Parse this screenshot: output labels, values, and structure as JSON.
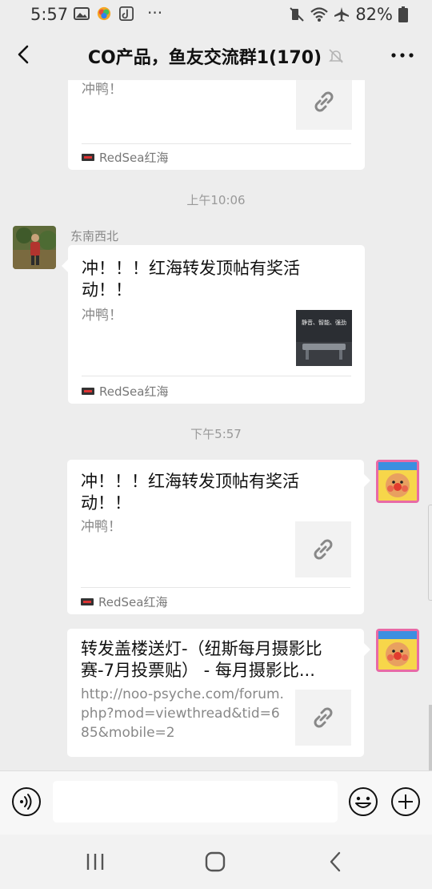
{
  "status_bar": {
    "time": "5:57",
    "battery": "82%"
  },
  "header": {
    "title": "CO产品，鱼友交流群1(170)"
  },
  "messages": [
    {
      "type": "card",
      "direction": "in",
      "title_tail": "冲鸭！",
      "source": "RedSea红海"
    },
    {
      "type": "timestamp",
      "text": "上午10:06"
    },
    {
      "type": "card",
      "direction": "in",
      "sender": "东南西北",
      "title": "冲！！！红海转发顶帖有奖活动！！",
      "desc": "冲鸭！",
      "thumb_text": "静音、智能、强劲",
      "source": "RedSea红海"
    },
    {
      "type": "timestamp",
      "text": "下午5:57"
    },
    {
      "type": "card",
      "direction": "out",
      "title": "冲！！！红海转发顶帖有奖活动！！",
      "desc": "冲鸭！",
      "source": "RedSea红海"
    },
    {
      "type": "card",
      "direction": "out",
      "title": "转发盖楼送灯-（纽斯每月摄影比赛-7月投票贴） - 每月摄影比...",
      "desc": "http://noo-psyche.com/forum.php?mod=viewthread&tid=685&mobile=2"
    }
  ],
  "colors": {
    "background": "#ededed",
    "bubble": "#ffffff",
    "thumb": "#f2f2f2"
  },
  "icons": [
    "back-icon",
    "mute-icon",
    "more-icon",
    "link-icon",
    "voice-icon",
    "emoji-icon",
    "plus-icon",
    "recent-apps-icon",
    "home-icon",
    "nav-back-icon"
  ]
}
